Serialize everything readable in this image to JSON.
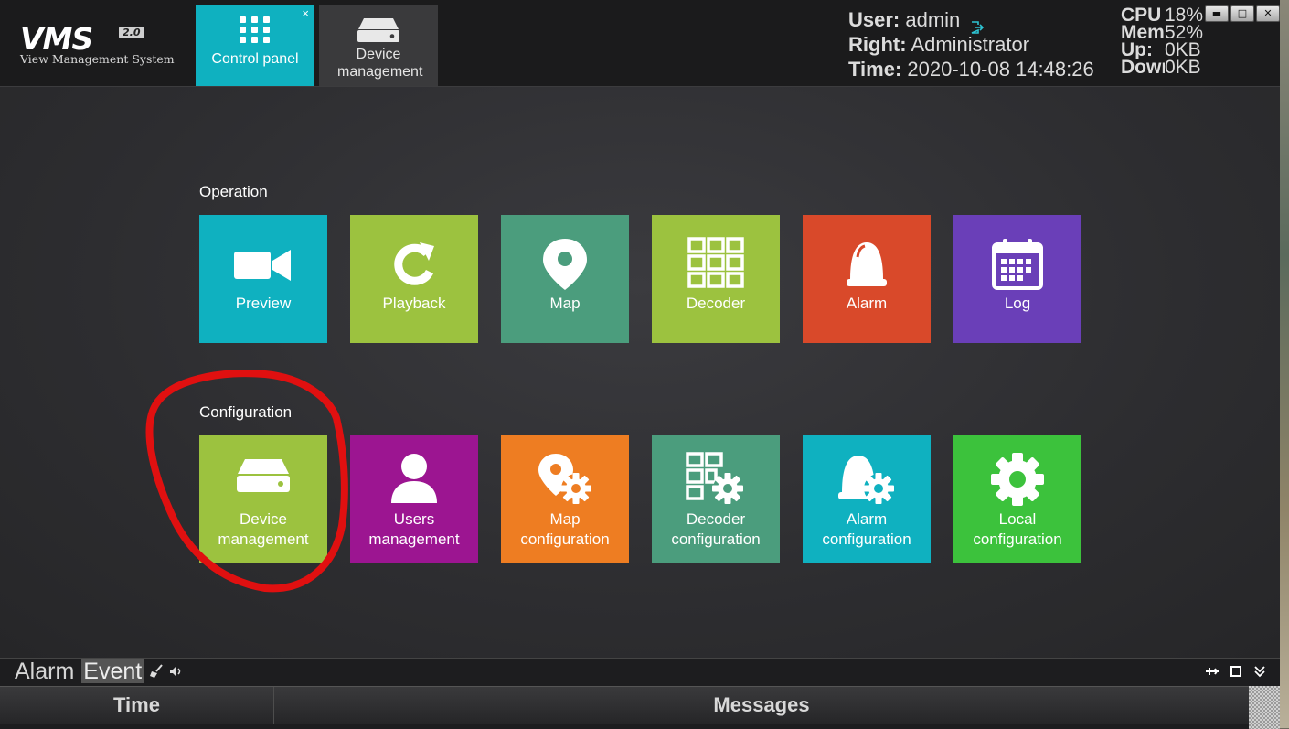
{
  "app": {
    "logo_main": "VMS",
    "logo_version": "2.0",
    "logo_subtitle": "View Management System"
  },
  "tabs": [
    {
      "label": "Control panel",
      "icon": "grid-icon",
      "active": true,
      "close": "×"
    },
    {
      "label": "Device management",
      "icon": "device-icon",
      "active": false
    }
  ],
  "user_info": {
    "user_key": "User:",
    "user_value": "admin",
    "right_key": "Right:",
    "right_value": "Administrator",
    "time_key": "Time:",
    "time_value": "2020-10-08 14:48:26"
  },
  "sys_stats": [
    {
      "key": "CPU",
      "value": "18%"
    },
    {
      "key": "Mem",
      "value": "52%"
    },
    {
      "key": "Up:",
      "value": "0KB"
    },
    {
      "key": "Down",
      "value": "0KB"
    }
  ],
  "window_controls": [
    "minimize",
    "maximize",
    "close"
  ],
  "sections": {
    "operation": {
      "title": "Operation",
      "tiles": [
        {
          "label": "Preview",
          "color": "#0fb1c0",
          "icon": "camera-icon"
        },
        {
          "label": "Playback",
          "color": "#9cc23f",
          "icon": "replay-icon"
        },
        {
          "label": "Map",
          "color": "#4b9d7d",
          "icon": "map-pin-icon"
        },
        {
          "label": "Decoder",
          "color": "#9cc23f",
          "icon": "decoder-grid-icon"
        },
        {
          "label": "Alarm",
          "color": "#d9492a",
          "icon": "alarm-bell-icon"
        },
        {
          "label": "Log",
          "color": "#6a3fb8",
          "icon": "calendar-icon"
        }
      ]
    },
    "configuration": {
      "title": "Configuration",
      "tiles": [
        {
          "label": "Device management",
          "color": "#9cc23f",
          "icon": "device-icon"
        },
        {
          "label": "Users management",
          "color": "#9c1591",
          "icon": "user-icon"
        },
        {
          "label": "Map configuration",
          "color": "#ee7d22",
          "icon": "map-gear-icon"
        },
        {
          "label": "Decoder configuration",
          "color": "#4b9d7d",
          "icon": "decoder-gear-icon"
        },
        {
          "label": "Alarm configuration",
          "color": "#0fb1c0",
          "icon": "alarm-gear-icon"
        },
        {
          "label": "Local configuration",
          "color": "#3cc23c",
          "icon": "gear-icon"
        }
      ]
    }
  },
  "bottom_panel": {
    "tabs": [
      {
        "label": "Alarm",
        "active": false
      },
      {
        "label": "Event",
        "active": true
      }
    ],
    "columns": [
      "Time",
      "Messages"
    ]
  },
  "annotation_color": "#e01010"
}
